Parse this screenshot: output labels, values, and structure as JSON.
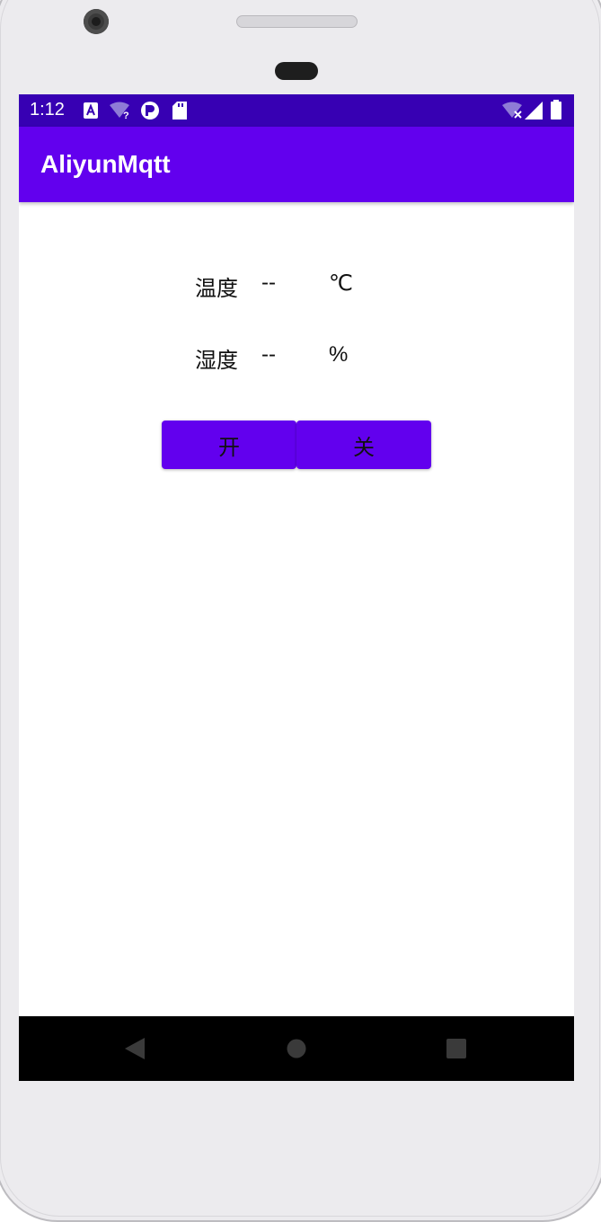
{
  "status_bar": {
    "time": "1:12",
    "left_icons": [
      "a-notification-icon",
      "wifi-question-icon",
      "p-notification-icon",
      "sd-card-icon"
    ],
    "right_icons": [
      "wifi-off-icon",
      "signal-icon",
      "battery-icon"
    ]
  },
  "app_bar": {
    "title": "AliyunMqtt"
  },
  "temperature": {
    "label": "温度",
    "value": "--",
    "unit": "℃"
  },
  "humidity": {
    "label": "湿度",
    "value": "--",
    "unit": "%"
  },
  "buttons": {
    "on_label": "开",
    "off_label": "关"
  },
  "nav_bar": {
    "icons": [
      "back-icon",
      "home-icon",
      "recents-icon"
    ]
  },
  "colors": {
    "status_bar": "#3700b3",
    "app_bar": "#6200ee",
    "button": "#6200ee",
    "nav_bar": "#000000"
  }
}
